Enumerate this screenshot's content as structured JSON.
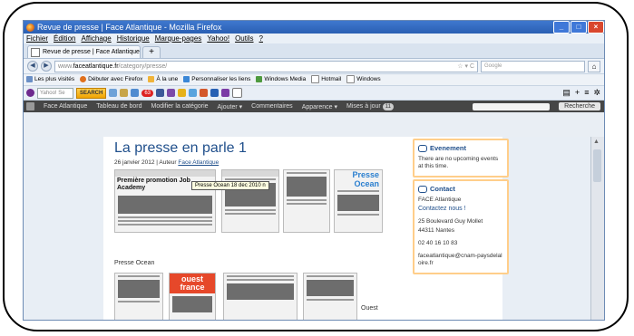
{
  "browser": {
    "window_title": "Revue de presse | Face Atlantique - Mozilla Firefox",
    "menu": [
      "Fichier",
      "Édition",
      "Affichage",
      "Historique",
      "Marque-pages",
      "Yahoo!",
      "Outils",
      "?"
    ],
    "tab_title": "Revue de presse | Face Atlantique",
    "new_tab": "+",
    "url_prefix": "www.",
    "url_domain": "faceatlantique.fr",
    "url_path": "/category/presse/",
    "search_placeholder": "Google",
    "bookmarks": [
      "Les plus visités",
      "Débuter avec Firefox",
      "À la une",
      "Personnaliser les liens",
      "Windows Media",
      "Hotmail",
      "Windows"
    ],
    "yahoo_placeholder": "Yahoo! Se",
    "yahoo_search": "SEARCH",
    "yahoo_badge": "63"
  },
  "adminbar": {
    "items": [
      "Face Atlantique",
      "Tableau de bord",
      "Modifier la catégorie",
      "Ajouter",
      "Commentaires",
      "Apparence",
      "Mises à jour"
    ],
    "updates_count": "11",
    "search_button": "Recherche"
  },
  "post": {
    "title": "La presse en parle 1",
    "date": "26 janvier 2012",
    "author_prefix": "| Auteur",
    "author": "Face Atlantique",
    "clip1_headline": "Première promotion Job Academy",
    "clip3_brand": "Presse Ocean",
    "tooltip": "Presse Ocean 18 dec 2010 n",
    "caption1": "Presse Ocean",
    "clip5_brand": "ouest france",
    "caption2": "Ouest"
  },
  "sidebar": {
    "event_title": "Evenement",
    "event_text": "There are no upcoming events at this time.",
    "contact_title": "Contact",
    "org": "FACE Atlantique",
    "contact_link": "Contactez nous !",
    "address1": "25 Boulevard Guy Mollet",
    "address2": "44311 Nantes",
    "phone": "02 40 16 10 83",
    "email": "faceatlantique@cnam-paysdelaloire.fr"
  }
}
